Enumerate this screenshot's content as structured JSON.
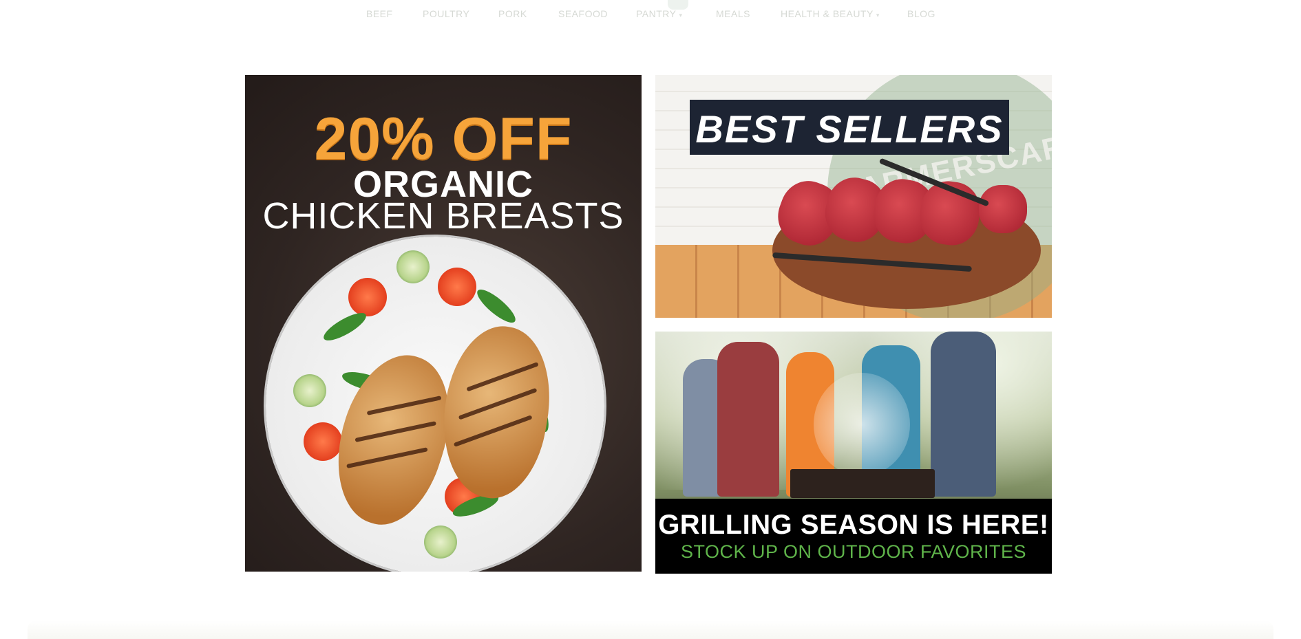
{
  "nav": {
    "items": [
      {
        "label": "BEEF"
      },
      {
        "label": "POULTRY"
      },
      {
        "label": "PORK"
      },
      {
        "label": "SEAFOOD"
      },
      {
        "label": "PANTRY"
      },
      {
        "label": "MEALS"
      },
      {
        "label": "HEALTH & BEAUTY"
      },
      {
        "label": "BLOG"
      }
    ]
  },
  "banners": {
    "chicken": {
      "discount": "20% OFF",
      "line1": "ORGANIC",
      "line2": "CHICKEN BREASTS"
    },
    "best_sellers": {
      "title": "BEST SELLERS",
      "watermark": "FARMERSCART"
    },
    "grilling": {
      "headline": "GRILLING SEASON IS HERE!",
      "subline": "STOCK UP ON OUTDOOR FAVORITES"
    }
  },
  "colors": {
    "promo_orange": "#f6a43a",
    "title_navy": "#1d2433",
    "subline_green": "#5fb44a",
    "nav_text": "#d6d9d4"
  }
}
